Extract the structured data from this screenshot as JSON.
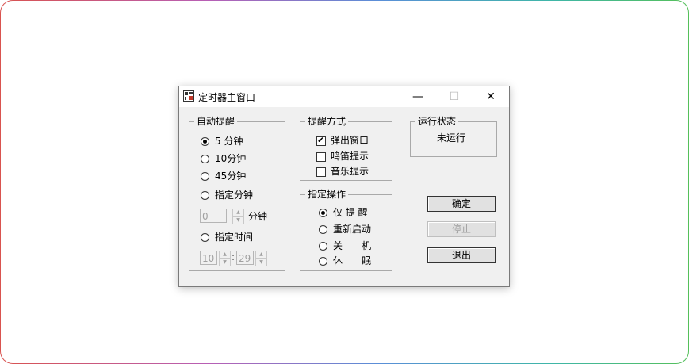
{
  "window": {
    "title": "定时器主窗口",
    "min_symbol": "—",
    "max_symbol": "☐",
    "close_symbol": "✕"
  },
  "auto_remind": {
    "legend": "自动提醒",
    "opt_5": "5 分钟",
    "opt_10": "10分钟",
    "opt_45": "45分钟",
    "opt_custom_minutes": "指定分钟",
    "minutes_value": "0",
    "minutes_unit": "分钟",
    "opt_custom_time": "指定时间",
    "hour_value": "10",
    "time_sep": ":",
    "minute_value": "29",
    "selected": "5 分钟"
  },
  "remind_method": {
    "legend": "提醒方式",
    "popup": "弹出窗口",
    "beep": "鸣笛提示",
    "music": "音乐提示",
    "popup_checked": true,
    "beep_checked": false,
    "music_checked": false
  },
  "run_status": {
    "legend": "运行状态",
    "value": "未运行"
  },
  "operation": {
    "legend": "指定操作",
    "remind_only": "仅 提 醒",
    "restart": "重新启动",
    "shutdown": "关　　机",
    "sleep": "休　　眠",
    "selected": "仅 提 醒"
  },
  "buttons": {
    "ok": "确定",
    "stop": "停止",
    "exit": "退出"
  }
}
